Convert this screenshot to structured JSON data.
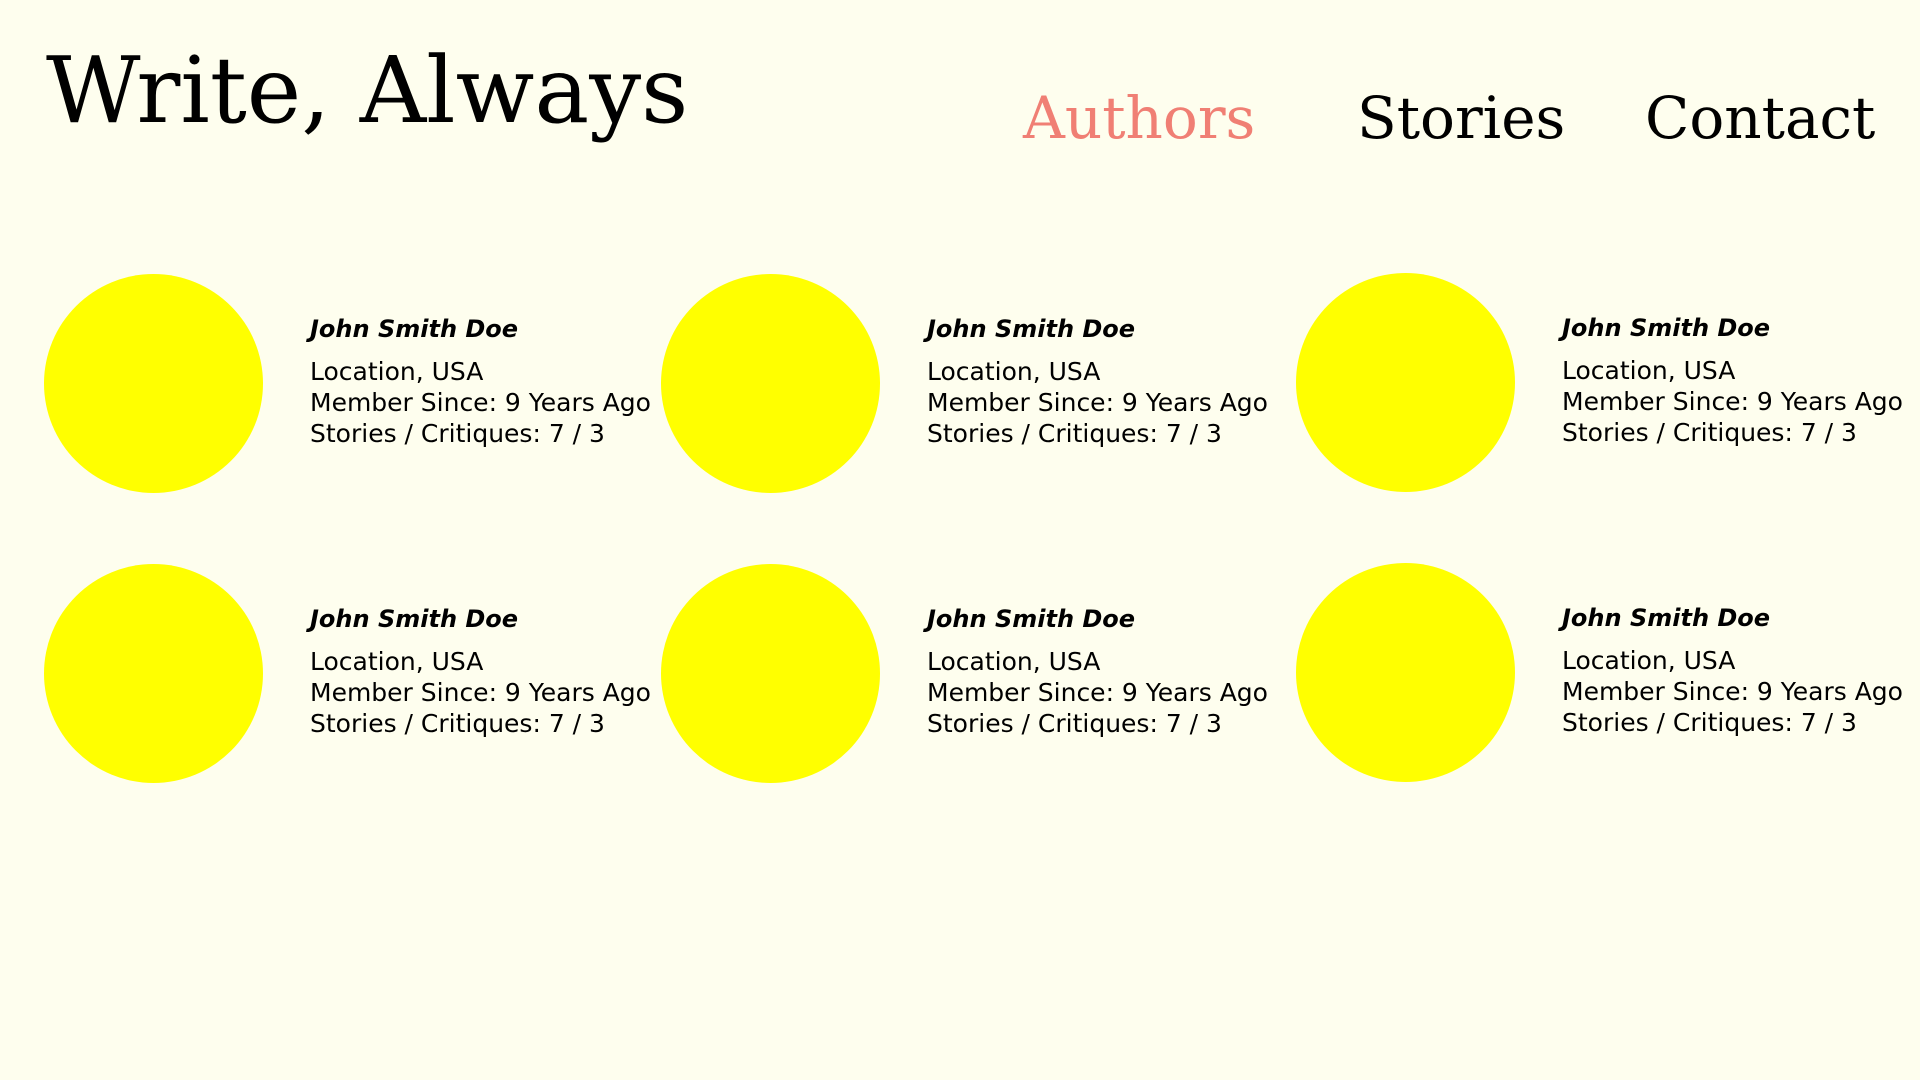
{
  "header": {
    "site_title": "Write, Always",
    "nav": [
      {
        "label": "Authors",
        "active": true
      },
      {
        "label": "Stories",
        "active": false
      },
      {
        "label": "Contact",
        "active": false
      }
    ]
  },
  "colors": {
    "background": "#fefeee",
    "active_nav": "#f07f74",
    "avatar": "#ffff00"
  },
  "authors": [
    {
      "name": "John Smith Doe",
      "location": "Location, USA",
      "member_since": "Member Since: 9 Years Ago",
      "stats": "Stories / Critiques: 7 / 3"
    },
    {
      "name": "John Smith Doe",
      "location": "Location, USA",
      "member_since": "Member Since: 9 Years Ago",
      "stats": "Stories / Critiques: 7 / 3"
    },
    {
      "name": "John Smith Doe",
      "location": "Location, USA",
      "member_since": "Member Since: 9 Years Ago",
      "stats": "Stories / Critiques: 7 / 3"
    },
    {
      "name": "John Smith Doe",
      "location": "Location, USA",
      "member_since": "Member Since: 9 Years Ago",
      "stats": "Stories / Critiques: 7 / 3"
    },
    {
      "name": "John Smith Doe",
      "location": "Location, USA",
      "member_since": "Member Since: 9 Years Ago",
      "stats": "Stories / Critiques: 7 / 3"
    },
    {
      "name": "John Smith Doe",
      "location": "Location, USA",
      "member_since": "Member Since: 9 Years Ago",
      "stats": "Stories / Critiques: 7 / 3"
    }
  ]
}
